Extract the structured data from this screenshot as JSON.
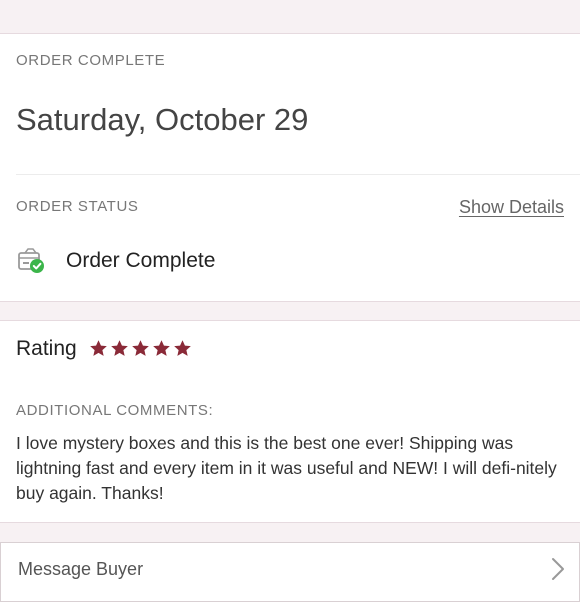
{
  "order": {
    "header": "ORDER COMPLETE",
    "date": "Saturday, October 29",
    "status_header": "ORDER STATUS",
    "show_details": "Show Details",
    "status_text": "Order Complete",
    "status_icon": "box-check-icon",
    "check_color": "#3bb54a"
  },
  "rating": {
    "label": "Rating",
    "stars": 5,
    "max_stars": 5,
    "star_color": "#8a2a38",
    "comments_header": "ADDITIONAL COMMENTS:",
    "comment": "I love mystery boxes and this is the best one ever! Shipping was lightning fast and every item in it was useful and NEW! I will defi-nitely buy again. Thanks!"
  },
  "message": {
    "label": "Message Buyer"
  }
}
